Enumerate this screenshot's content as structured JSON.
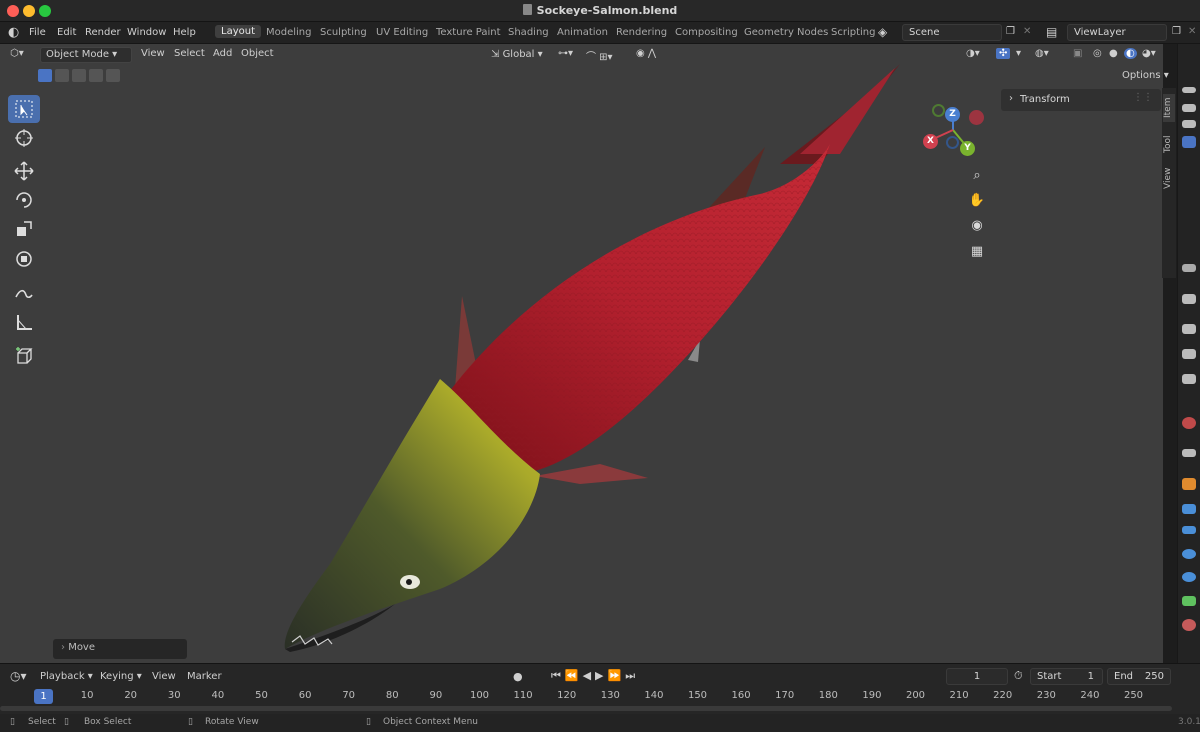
{
  "window": {
    "title": "Sockeye-Salmon.blend"
  },
  "menu": [
    "File",
    "Edit",
    "Render",
    "Window",
    "Help"
  ],
  "workspaces": [
    "Layout",
    "Modeling",
    "Sculpting",
    "UV Editing",
    "Texture Paint",
    "Shading",
    "Animation",
    "Rendering",
    "Compositing",
    "Geometry Nodes",
    "Scripting"
  ],
  "scene": {
    "name": "Scene",
    "view_layer": "ViewLayer"
  },
  "viewport_header": {
    "mode": "Object Mode",
    "menus": [
      "View",
      "Select",
      "Add",
      "Object"
    ],
    "orientation": "Global",
    "options_label": "Options"
  },
  "sidebar": {
    "panel": "Transform",
    "tabs": [
      "Item",
      "Tool",
      "View"
    ]
  },
  "gizmo": {
    "x": "X",
    "y": "Y",
    "z": "Z"
  },
  "operator_panel": {
    "label": "Move"
  },
  "timeline": {
    "menus": [
      "Playback",
      "Keying",
      "View",
      "Marker"
    ],
    "current_frame": "1",
    "start_label": "Start",
    "start": "1",
    "end_label": "End",
    "end": "250",
    "ticks": [
      "10",
      "20",
      "30",
      "40",
      "50",
      "60",
      "70",
      "80",
      "90",
      "100",
      "110",
      "120",
      "130",
      "140",
      "150",
      "160",
      "170",
      "180",
      "190",
      "200",
      "210",
      "220",
      "230",
      "240",
      "250"
    ]
  },
  "status": {
    "select": "Select",
    "box_select": "Box Select",
    "rotate": "Rotate View",
    "context": "Object Context Menu",
    "version": "3.0.1"
  },
  "colors": {
    "accent": "#4a74c4",
    "viewport_bg": "#3d3d3d",
    "salmon_red": "#b0202c",
    "salmon_head": "#b5b52a"
  }
}
